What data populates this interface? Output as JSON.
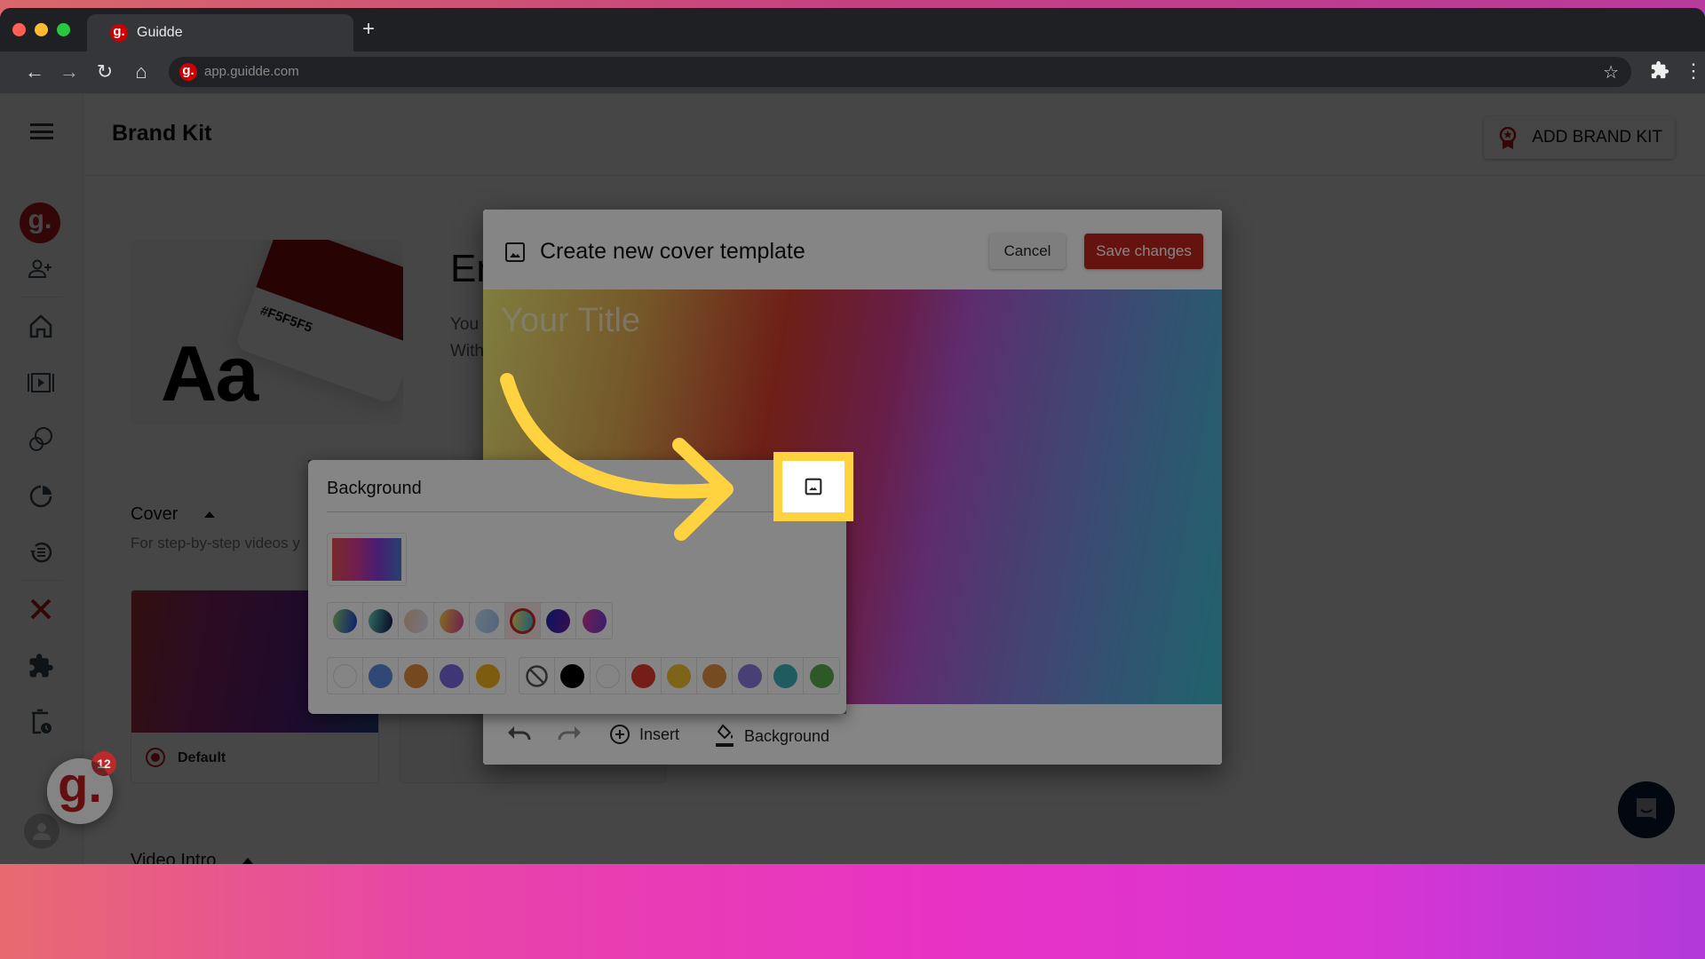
{
  "browser": {
    "tab_title": "Guidde",
    "tab_favicon": "g.",
    "new_tab_icon": "+",
    "url": "app.guidde.com",
    "traffic_colors": [
      "#ff5f57",
      "#febc2e",
      "#28c840"
    ]
  },
  "sidebar": {
    "logo": "g.",
    "items": [
      {
        "icon": "add-user-icon"
      },
      {
        "icon": "home-icon"
      },
      {
        "icon": "video-library-icon"
      },
      {
        "icon": "spaces-icon"
      },
      {
        "icon": "analytics-icon"
      },
      {
        "icon": "history-icon"
      },
      {
        "icon": "brand-kit-icon",
        "active": true
      },
      {
        "icon": "extension-icon"
      },
      {
        "icon": "trash-clock-icon"
      }
    ]
  },
  "header": {
    "title": "Brand Kit",
    "add_button": "ADD BRAND KIT"
  },
  "brand": {
    "sample": "Aa",
    "color_hex": "#F5F5F5",
    "title_partial": "Er",
    "text_line1_partial": "You",
    "text_line2_partial": "With"
  },
  "cover_section": {
    "title": "Cover",
    "subtitle": "For step-by-step videos y",
    "default_label": "Default"
  },
  "video_intro_section": {
    "title": "Video Intro"
  },
  "guidde_bubble": {
    "logo": "g.",
    "badge": "12"
  },
  "modal": {
    "title": "Create new cover template",
    "cancel": "Cancel",
    "save": "Save changes",
    "canvas_title": "Your Title",
    "footer": {
      "insert": "Insert",
      "background": "Background"
    }
  },
  "popover": {
    "title": "Background",
    "gradients": [
      {
        "from": "#8ad06a",
        "to": "#1a3ad8",
        "selected": false
      },
      {
        "from": "#5ad0c0",
        "to": "#101040",
        "selected": false
      },
      {
        "from": "#f0c8a0",
        "to": "#e0e0ff",
        "selected": false
      },
      {
        "from": "#f8d040",
        "to": "#d83a9a",
        "selected": false
      },
      {
        "from": "#c0e0f0",
        "to": "#a0c0f0",
        "selected": false
      },
      {
        "from": "#f8e060",
        "to": "#3ab0e0",
        "selected": true
      },
      {
        "from": "#1a2ab0",
        "to": "#6a1aa0",
        "selected": false
      },
      {
        "from": "#d83a9a",
        "to": "#6a3ad8",
        "selected": false
      }
    ],
    "brand_colors": [
      "#ffffff",
      "#5a8ae0",
      "#e08a3a",
      "#7a6ae0",
      "#f0b020"
    ],
    "solid_colors": [
      "none",
      "#000000",
      "#ffffff",
      "#e03a30",
      "#f0c030",
      "#e09040",
      "#8a7ae0",
      "#3ab0b8",
      "#5aaa50"
    ]
  },
  "annotation": {
    "color": "#ffd23f"
  }
}
